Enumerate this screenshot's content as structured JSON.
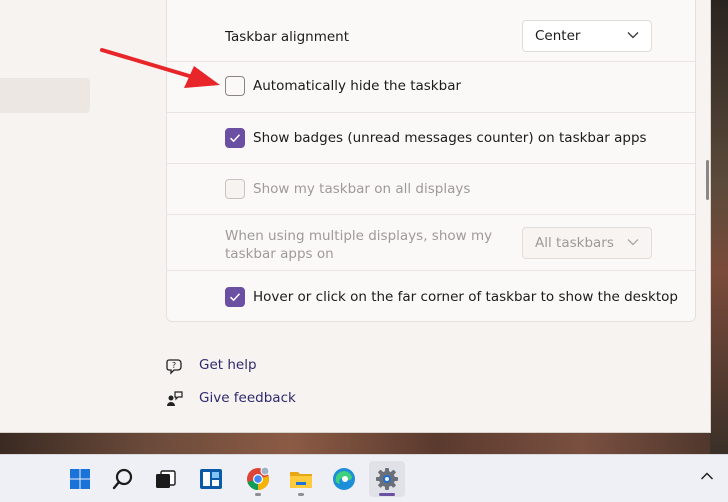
{
  "settings": {
    "taskbar_alignment": {
      "label": "Taskbar alignment",
      "value": "Center"
    },
    "auto_hide": {
      "label": "Automatically hide the taskbar",
      "checked": false
    },
    "show_badges": {
      "label": "Show badges (unread messages counter) on taskbar apps",
      "checked": true
    },
    "all_displays": {
      "label": "Show my taskbar on all displays",
      "checked": false,
      "disabled": true
    },
    "multi_display": {
      "label_line1": "When using multiple displays, show my",
      "label_line2": "taskbar apps on",
      "value": "All taskbars",
      "disabled": true
    },
    "far_corner": {
      "label": "Hover or click on the far corner of taskbar to show the desktop",
      "checked": true
    }
  },
  "links": {
    "get_help": "Get help",
    "give_feedback": "Give feedback"
  },
  "taskbar": {
    "icons": [
      "windows-start-icon",
      "search-icon",
      "task-view-icon",
      "widgets-icon",
      "chrome-icon",
      "file-explorer-icon",
      "edge-icon",
      "settings-icon"
    ]
  },
  "colors": {
    "accent": "#6b4fa3",
    "annotation_arrow": "#e8262a"
  }
}
